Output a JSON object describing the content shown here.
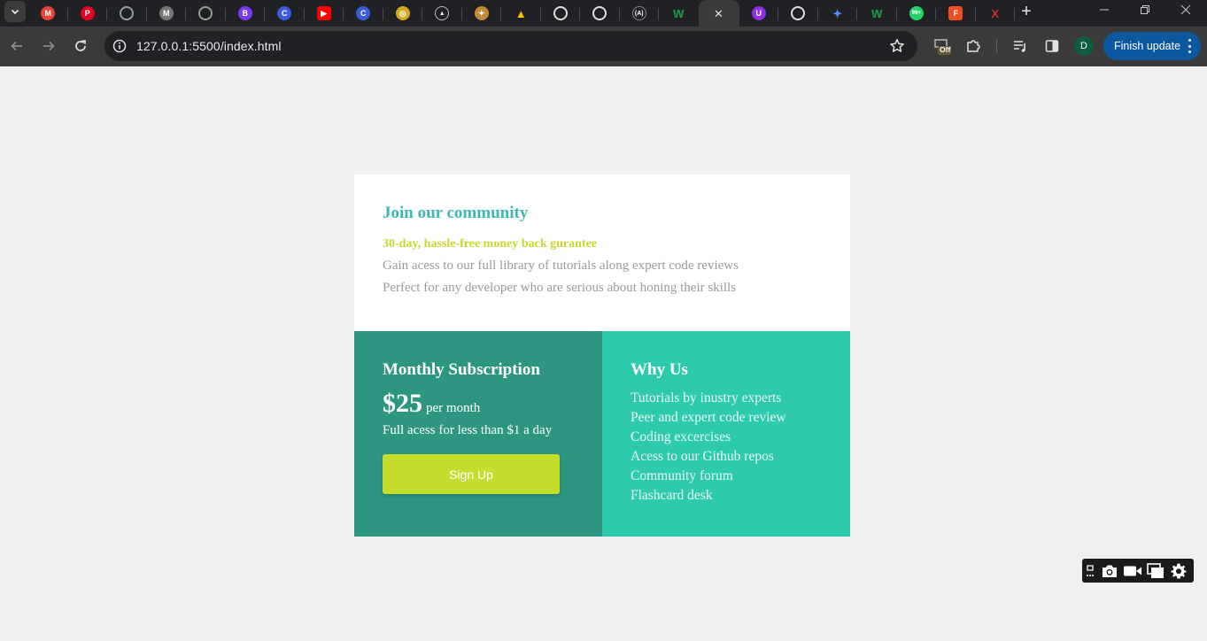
{
  "browser": {
    "tabs": [
      {
        "icon": "tab-search-chevron-icon"
      },
      {
        "icon": "gmail-icon",
        "color": "#ea4335",
        "glyph": "M"
      },
      {
        "icon": "pinterest-icon",
        "color": "#e60023",
        "glyph": "P"
      },
      {
        "icon": "openai-icon",
        "color": "#8e9f96",
        "glyph": ""
      },
      {
        "icon": "medium-icon",
        "color": "#777777",
        "glyph": "M"
      },
      {
        "icon": "chatgpt-icon",
        "color": "#8e9f96",
        "glyph": ""
      },
      {
        "icon": "bootstrap-icon",
        "color": "#7a37f5",
        "glyph": "B"
      },
      {
        "icon": "codecademy-icon",
        "color": "#3b5bdb",
        "glyph": "C"
      },
      {
        "icon": "youtube-icon",
        "color": "#ff0000",
        "glyph": "▶"
      },
      {
        "icon": "coursera-icon",
        "color": "#3b5bdb",
        "glyph": "C"
      },
      {
        "icon": "coin-icon",
        "color": "#d4a91c",
        "glyph": "◎"
      },
      {
        "icon": "vercel-icon",
        "color": "#ffffff",
        "glyph": "▲"
      },
      {
        "icon": "seal-icon",
        "color": "#c08a3a",
        "glyph": "✦"
      },
      {
        "icon": "google-drive-icon",
        "color": "#fbbc04",
        "glyph": "▲"
      },
      {
        "icon": "circle-icon",
        "color": "#dddddd",
        "glyph": ""
      },
      {
        "icon": "github-icon",
        "color": "#dddddd",
        "glyph": ""
      },
      {
        "icon": "code-icon",
        "color": "#202124",
        "glyph": "(A)"
      },
      {
        "icon": "webflow-icon",
        "color": "#16a34a",
        "glyph": "W"
      },
      {
        "icon": "close-tab-icon",
        "color": "#e3e3e3",
        "glyph": "✕",
        "active": true
      },
      {
        "icon": "udemy-icon",
        "color": "#8f2ee6",
        "glyph": "U"
      },
      {
        "icon": "chrome-icon",
        "color": "#dddddd",
        "glyph": ""
      },
      {
        "icon": "gemini-icon",
        "color": "#4c8df6",
        "glyph": "✦"
      },
      {
        "icon": "webflow-icon",
        "color": "#16a34a",
        "glyph": "W"
      },
      {
        "icon": "whatsapp-icon",
        "color": "#25d366",
        "glyph": "99+"
      },
      {
        "icon": "figma-icon",
        "color": "#f24e1e",
        "glyph": "F"
      },
      {
        "icon": "x-icon",
        "color": "#d22a2a",
        "glyph": "X"
      }
    ],
    "new_tab": "+",
    "url": "127.0.0.1:5500/index.html",
    "profile_initial": "D",
    "extension_badge": "Off",
    "update_label": "Finish update"
  },
  "page": {
    "title": "Join our community",
    "subtitle": "30-day, hassle-free money back gurantee",
    "desc_1": "Gain acess to our full library of tutorials along expert code reviews",
    "desc_2": "Perfect for any developer who are serious about honing their skills",
    "monthly": {
      "title": "Monthly Subscription",
      "price": "$25",
      "per": "per month",
      "note": "Full acess for less than $1 a day",
      "button": "Sign Up"
    },
    "why": {
      "title": "Why Us",
      "items": [
        "Tutorials by inustry experts",
        "Peer and expert code review",
        "Coding excercises",
        "Acess to our Github repos",
        "Community forum",
        "Flashcard desk"
      ]
    }
  },
  "colors": {
    "title_teal": "#3bb8b4",
    "accent_lime": "#c4d82e",
    "dark_teal": "#2c9680",
    "light_teal": "#2dcaab",
    "button": "#c4dd2d"
  }
}
